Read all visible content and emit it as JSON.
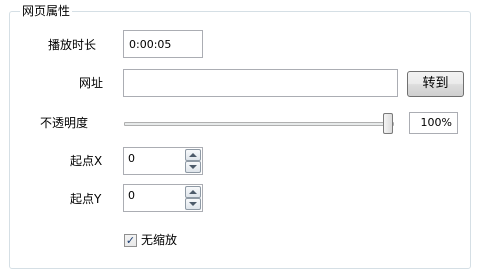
{
  "group": {
    "title": "网页属性"
  },
  "fields": {
    "duration": {
      "label": "播放时长",
      "value": "0:00:05"
    },
    "url": {
      "label": "网址",
      "value": "",
      "go_button": "转到"
    },
    "opacity": {
      "label": "不透明度",
      "percent_text": "100%",
      "level_percent": 100
    },
    "start_x": {
      "label": "起点X",
      "value": "0"
    },
    "start_y": {
      "label": "起点Y",
      "value": "0"
    },
    "no_zoom": {
      "label": "无缩放",
      "checked": true
    }
  },
  "icons": {
    "spin_up": "arrow-up-icon",
    "spin_down": "arrow-down-icon",
    "checkbox": "check-mark-icon"
  }
}
